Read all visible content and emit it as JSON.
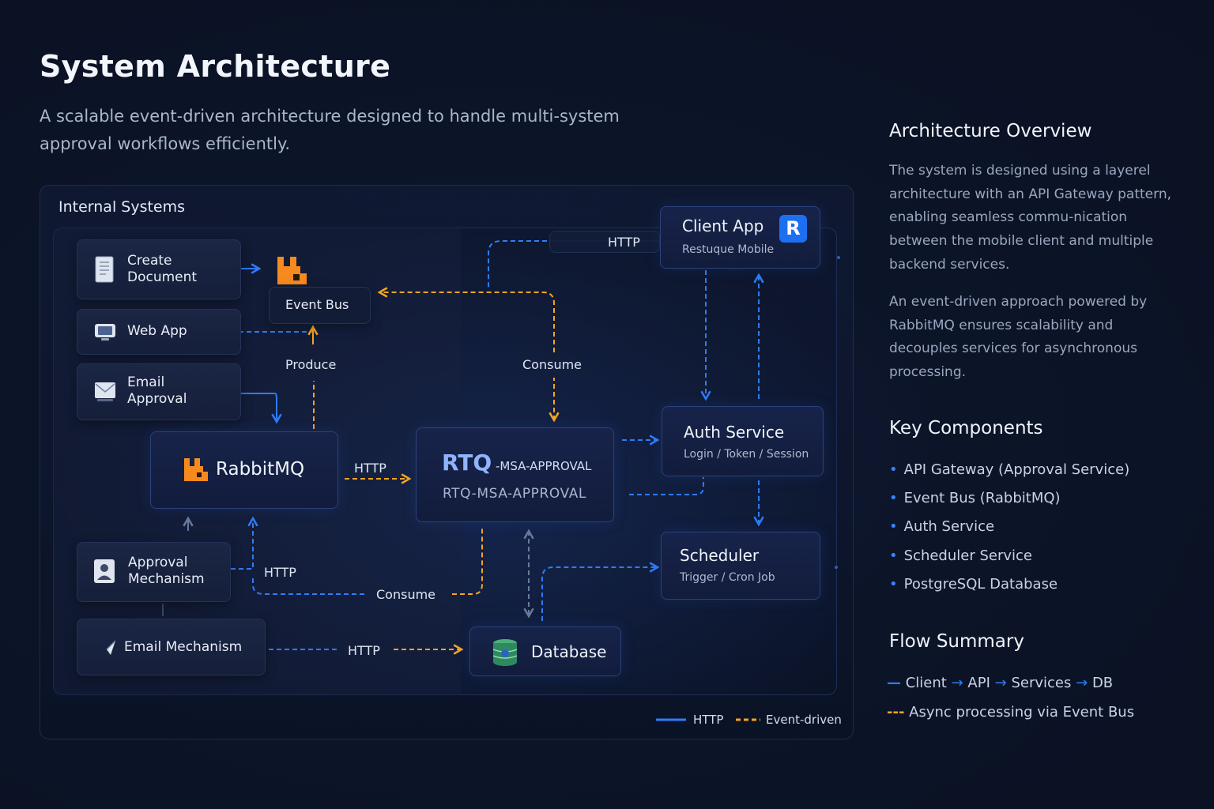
{
  "header": {
    "title": "System Architecture",
    "subtitle": "A scalable event-driven architecture designed to handle multi-system approval workflows efficiently."
  },
  "diagram": {
    "internal_title": "Internal Systems",
    "internal_items": [
      {
        "label": "Create Document",
        "icon": "document-icon"
      },
      {
        "label": "Web App",
        "icon": "monitor-icon"
      },
      {
        "label": "Email Approval",
        "icon": "envelope-icon"
      },
      {
        "label": "Approval Mechanism",
        "icon": "user-badge-icon"
      },
      {
        "label": "Email Mechanism",
        "icon": "paper-plane-icon"
      }
    ],
    "event_bus": "Event Bus",
    "rabbitmq": "RabbitMQ",
    "rtq": {
      "logo": "RTQ",
      "suffix": "-MSA-APPROVAL",
      "name": "RTQ-MSA-APPROVAL"
    },
    "client_app": {
      "title": "Client App",
      "subtitle": "Restuque Mobile",
      "badge": "R"
    },
    "auth_service": {
      "title": "Auth Service",
      "subtitle": "Login / Token / Session"
    },
    "scheduler": {
      "title": "Scheduler",
      "subtitle": "Trigger / Cron Job"
    },
    "database": "Database",
    "labels": {
      "http_top": "HTTP",
      "produce": "Produce",
      "consume_top": "Consume",
      "http_rabbit": "HTTP",
      "http_approval": "HTTP",
      "consume_bottom": "Consume",
      "http_email": "HTTP"
    },
    "legend": {
      "http": "HTTP",
      "event": "Event-driven"
    }
  },
  "sidebar": {
    "overview_title": "Architecture Overview",
    "overview_p1": "The system is designed using a layerel architecture with an API Gateway pattern, enabling seamless commu-nication between the mobile client and multiple backend services.",
    "overview_p2": "An event-driven approach powered by RabbitMQ ensures scalability and decouples services for asynchronous processing.",
    "components_title": "Key Components",
    "components": [
      "API Gateway (Approval Service)",
      "Event Bus (RabbitMQ)",
      "Auth Service",
      "Scheduler Service",
      "PostgreSQL Database"
    ],
    "flow_title": "Flow Summary",
    "flow": {
      "http_steps": [
        "Client",
        "API",
        "Services",
        "DB"
      ],
      "async": "Async processing via Event Bus"
    }
  },
  "colors": {
    "http_line": "#2f7cf6",
    "event_line": "#f5a524",
    "accent_orange": "#f68a1f",
    "badge_blue": "#1d6ff2"
  }
}
